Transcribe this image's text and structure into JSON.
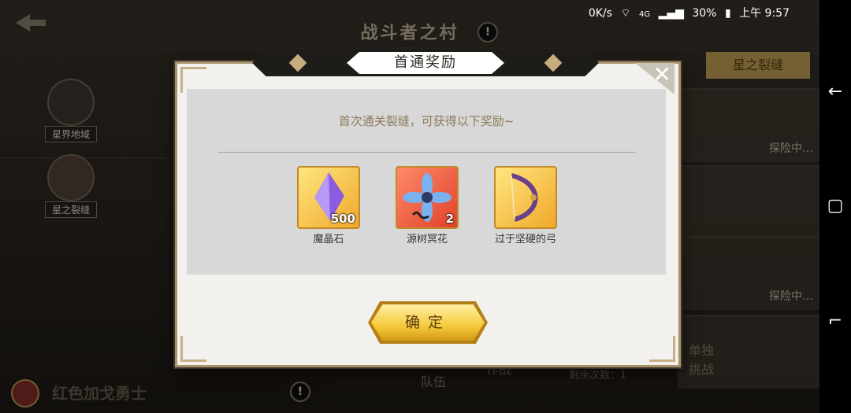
{
  "statusbar": {
    "net_speed": "0K/s",
    "signal": "4G",
    "battery": "30%",
    "time": "上午 9:57"
  },
  "background": {
    "title": "战斗者之村",
    "nav_items": [
      {
        "label": "星界地域"
      },
      {
        "label": "星之裂缝"
      }
    ],
    "star_tab": "星之裂缝",
    "card_status": "探险中…",
    "hero_name": "红色加戈勇士",
    "btn_team": "调整\n队伍",
    "btn_battle": "团队\n作战",
    "btn_solo": "单独\n挑战",
    "remain_label": "剩余次数：1"
  },
  "dialog": {
    "title": "首通奖励",
    "subtitle": "首次通关裂缝，可获得以下奖励~",
    "rewards": [
      {
        "name": "魔晶石",
        "qty": "500",
        "icon": "purple-crystal-icon"
      },
      {
        "name": "源树冥花",
        "qty": "2",
        "icon": "blue-flower-icon"
      },
      {
        "name": "过于坚硬的弓",
        "qty": "",
        "icon": "bow-icon"
      }
    ],
    "confirm_label": "确定"
  },
  "colors": {
    "accent_gold": "#f5c93b",
    "frame_gold": "#a8916a",
    "text_brown": "#8d7a5a"
  }
}
